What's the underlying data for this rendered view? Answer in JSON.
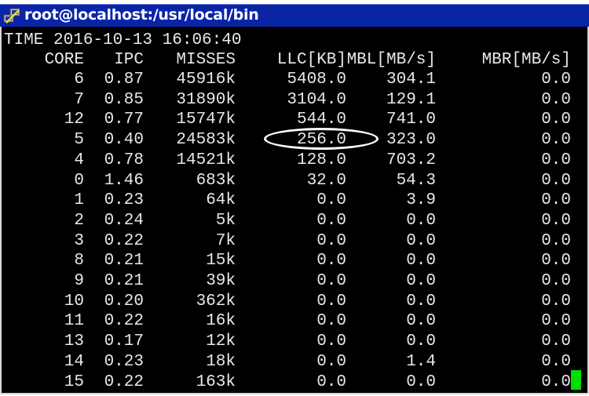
{
  "window": {
    "title": "root@localhost:/usr/local/bin"
  },
  "terminal": {
    "time_line": "TIME 2016-10-13 16:06:40",
    "headers": [
      "CORE",
      "IPC",
      "MISSES",
      "LLC[KB]",
      "MBL[MB/s]",
      "MBR[MB/s]"
    ],
    "rows": [
      [
        "6",
        "0.87",
        "45916k",
        "5408.0",
        "304.1",
        "0.0"
      ],
      [
        "7",
        "0.85",
        "31890k",
        "3104.0",
        "129.1",
        "0.0"
      ],
      [
        "12",
        "0.77",
        "15747k",
        "544.0",
        "741.0",
        "0.0"
      ],
      [
        "5",
        "0.40",
        "24583k",
        "256.0",
        "323.0",
        "0.0"
      ],
      [
        "4",
        "0.78",
        "14521k",
        "128.0",
        "703.2",
        "0.0"
      ],
      [
        "0",
        "1.46",
        "683k",
        "32.0",
        "54.3",
        "0.0"
      ],
      [
        "1",
        "0.23",
        "64k",
        "0.0",
        "3.9",
        "0.0"
      ],
      [
        "2",
        "0.24",
        "5k",
        "0.0",
        "0.0",
        "0.0"
      ],
      [
        "3",
        "0.22",
        "7k",
        "0.0",
        "0.0",
        "0.0"
      ],
      [
        "8",
        "0.21",
        "15k",
        "0.0",
        "0.0",
        "0.0"
      ],
      [
        "9",
        "0.21",
        "39k",
        "0.0",
        "0.0",
        "0.0"
      ],
      [
        "10",
        "0.20",
        "362k",
        "0.0",
        "0.0",
        "0.0"
      ],
      [
        "11",
        "0.22",
        "16k",
        "0.0",
        "0.0",
        "0.0"
      ],
      [
        "13",
        "0.17",
        "12k",
        "0.0",
        "0.0",
        "0.0"
      ],
      [
        "14",
        "0.23",
        "18k",
        "0.0",
        "1.4",
        "0.0"
      ],
      [
        "15",
        "0.22",
        "163k",
        "0.0",
        "0.0",
        "0.0"
      ]
    ],
    "highlighted_cell": "256.0",
    "cursor_color": "#00e000"
  }
}
